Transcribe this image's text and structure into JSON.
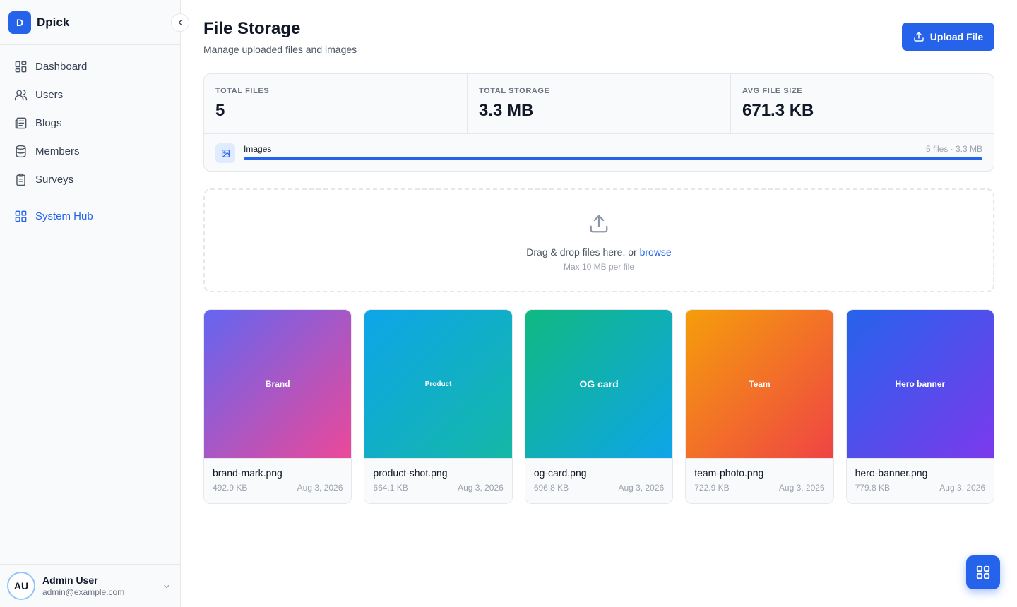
{
  "app": {
    "logo_letter": "D",
    "name": "Dpick"
  },
  "sidebar": {
    "items": [
      {
        "label": "Dashboard",
        "icon": "dashboard-icon"
      },
      {
        "label": "Users",
        "icon": "users-icon"
      },
      {
        "label": "Blogs",
        "icon": "blogs-icon"
      },
      {
        "label": "Members",
        "icon": "database-icon"
      },
      {
        "label": "Surveys",
        "icon": "clipboard-icon"
      }
    ],
    "active_item": {
      "label": "System Hub",
      "icon": "grid-icon"
    },
    "user": {
      "initials": "AU",
      "name": "Admin User",
      "email": "admin@example.com"
    }
  },
  "header": {
    "title": "File Storage",
    "subtitle": "Manage uploaded files and images",
    "upload_label": "Upload File"
  },
  "stats": [
    {
      "label": "TOTAL FILES",
      "value": "5"
    },
    {
      "label": "TOTAL STORAGE",
      "value": "3.3 MB"
    },
    {
      "label": "AVG FILE SIZE",
      "value": "671.3 KB"
    }
  ],
  "category": {
    "label": "Images",
    "meta": "5 files · 3.3 MB",
    "fill_percent": 100
  },
  "dropzone": {
    "text": "Drag & drop files here, or ",
    "browse": "browse",
    "hint": "Max 10 MB per file"
  },
  "files": [
    {
      "thumb_label": "Brand",
      "name": "brand-mark.png",
      "size": "492.9 KB",
      "date": "Aug 3, 2026",
      "gradient": [
        "#6366f1",
        "#ec4899"
      ],
      "label_size": "small"
    },
    {
      "thumb_label": "Product",
      "name": "product-shot.png",
      "size": "664.1 KB",
      "date": "Aug 3, 2026",
      "gradient": [
        "#0ea5e9",
        "#14b8a6"
      ],
      "label_size": "tiny"
    },
    {
      "thumb_label": "OG card",
      "name": "og-card.png",
      "size": "696.8 KB",
      "date": "Aug 3, 2026",
      "gradient": [
        "#10b981",
        "#0ea5e9"
      ],
      "label_size": "medium"
    },
    {
      "thumb_label": "Team",
      "name": "team-photo.png",
      "size": "722.9 KB",
      "date": "Aug 3, 2026",
      "gradient": [
        "#f59e0b",
        "#ef4444"
      ],
      "label_size": "small"
    },
    {
      "thumb_label": "Hero banner",
      "name": "hero-banner.png",
      "size": "779.8 KB",
      "date": "Aug 3, 2026",
      "gradient": [
        "#2563eb",
        "#7c3aed"
      ],
      "label_size": "small"
    }
  ],
  "colors": {
    "accent": "#2563eb",
    "sidebar_bg": "#f8fafc",
    "border": "#e5e7eb"
  }
}
